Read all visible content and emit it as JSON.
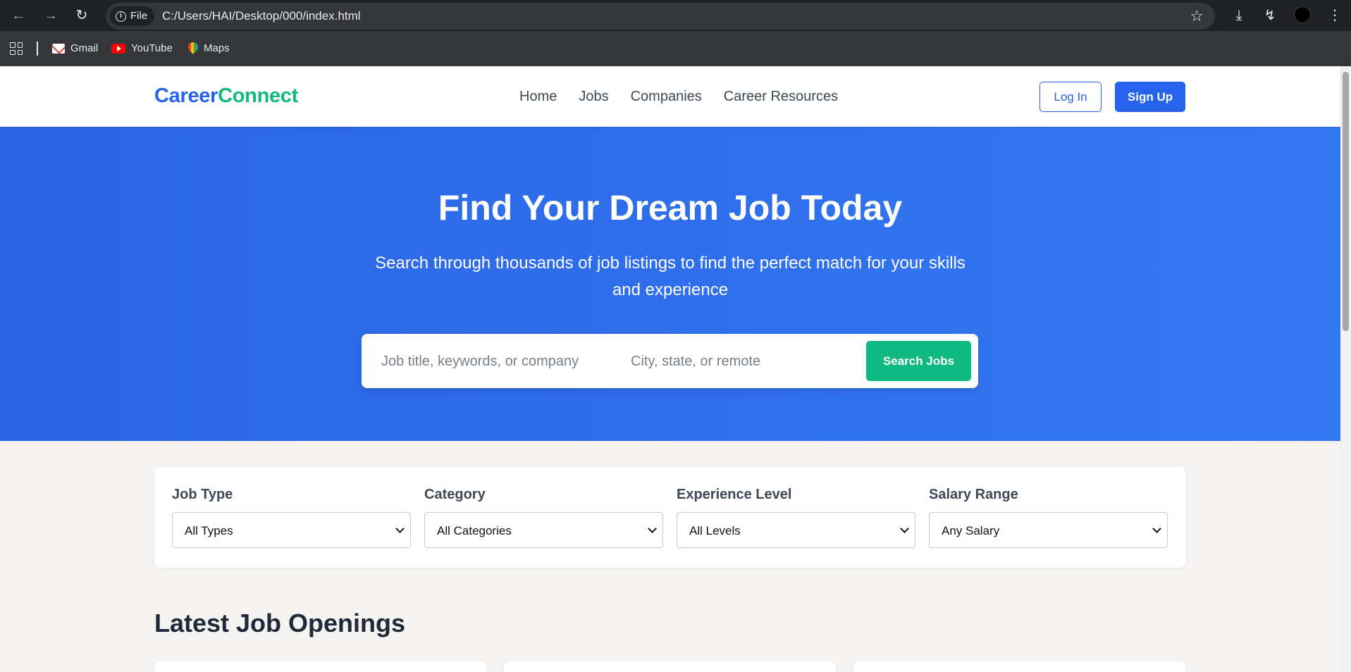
{
  "browser": {
    "file_chip": "File",
    "url": "C:/Users/HAI/Desktop/000/index.html",
    "bookmarks": [
      {
        "label": "Gmail",
        "icon": "gmail-icon"
      },
      {
        "label": "YouTube",
        "icon": "youtube-icon"
      },
      {
        "label": "Maps",
        "icon": "maps-icon"
      }
    ]
  },
  "header": {
    "logo_part1": "Career",
    "logo_part2": "Connect",
    "nav": [
      "Home",
      "Jobs",
      "Companies",
      "Career Resources"
    ],
    "login": "Log In",
    "signup": "Sign Up"
  },
  "hero": {
    "title": "Find Your Dream Job Today",
    "subtitle": "Search through thousands of job listings to find the perfect match for your skills and experience",
    "keyword_placeholder": "Job title, keywords, or company",
    "location_placeholder": "City, state, or remote",
    "search_button": "Search Jobs"
  },
  "filters": [
    {
      "label": "Job Type",
      "value": "All Types"
    },
    {
      "label": "Category",
      "value": "All Categories"
    },
    {
      "label": "Experience Level",
      "value": "All Levels"
    },
    {
      "label": "Salary Range",
      "value": "Any Salary"
    }
  ],
  "section": {
    "title": "Latest Job Openings"
  },
  "colors": {
    "primary": "#2563eb",
    "accent": "#10b981",
    "hero_gradient_start": "#2a65e4",
    "hero_gradient_end": "#3478f3"
  }
}
